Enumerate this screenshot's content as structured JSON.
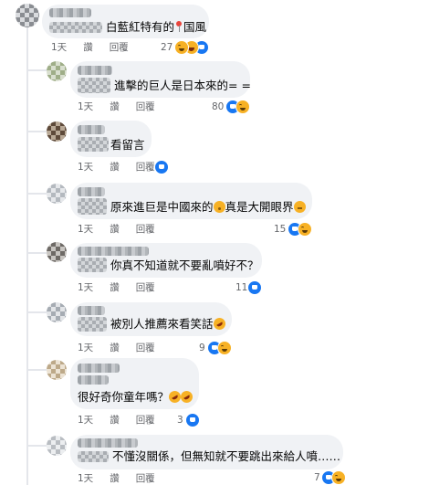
{
  "comments": [
    {
      "id": "c1",
      "text_before": "白藍紅特有的",
      "text_after": "国風",
      "time": "1天",
      "like_label": "讚",
      "reply_label": "回覆",
      "reaction_count": "27",
      "reactions": [
        "like-icon",
        "laugh-icon",
        "haha-icon"
      ]
    },
    {
      "id": "c2",
      "text": "進擊的巨人是日本來的= =",
      "time": "1天",
      "like_label": "讚",
      "reply_label": "回覆",
      "reaction_count": "80",
      "reactions": [
        "like-icon",
        "haha-icon"
      ]
    },
    {
      "id": "c3",
      "text": "看留言",
      "time": "1天",
      "like_label": "讚",
      "reply_label": "回覆",
      "reaction_count": "",
      "reactions": [
        "like-icon"
      ]
    },
    {
      "id": "c4",
      "text_before": "原來進巨是中國來的",
      "text_middle": "真是大開眼界",
      "time": "1天",
      "like_label": "讚",
      "reply_label": "回覆",
      "reaction_count": "15",
      "reactions": [
        "like-icon",
        "haha-icon"
      ]
    },
    {
      "id": "c5",
      "text": "你真不知道就不要亂噴好不？",
      "time": "1天",
      "like_label": "讚",
      "reply_label": "回覆",
      "reaction_count": "11",
      "reactions": [
        "like-icon"
      ]
    },
    {
      "id": "c6",
      "text": "被別人推薦來看笑話",
      "time": "1天",
      "like_label": "讚",
      "reply_label": "回覆",
      "reaction_count": "9",
      "reactions": [
        "like-icon",
        "haha-icon"
      ]
    },
    {
      "id": "c7",
      "text": "很好奇你童年嗎？",
      "time": "1天",
      "like_label": "讚",
      "reply_label": "回覆",
      "reaction_count": "3",
      "reactions": [
        "like-icon"
      ]
    },
    {
      "id": "c8",
      "text": "不懂沒關係，但無知就不要跳出來給人噴……",
      "time": "1天",
      "like_label": "讚",
      "reply_label": "回覆",
      "reaction_count": "7",
      "reactions": [
        "like-icon",
        "haha-icon"
      ]
    }
  ],
  "colors": {
    "bubble": "#f0f2f5",
    "meta_text": "#65676b",
    "like_blue": "#1877f2",
    "haha_yellow": "#f7b125"
  }
}
